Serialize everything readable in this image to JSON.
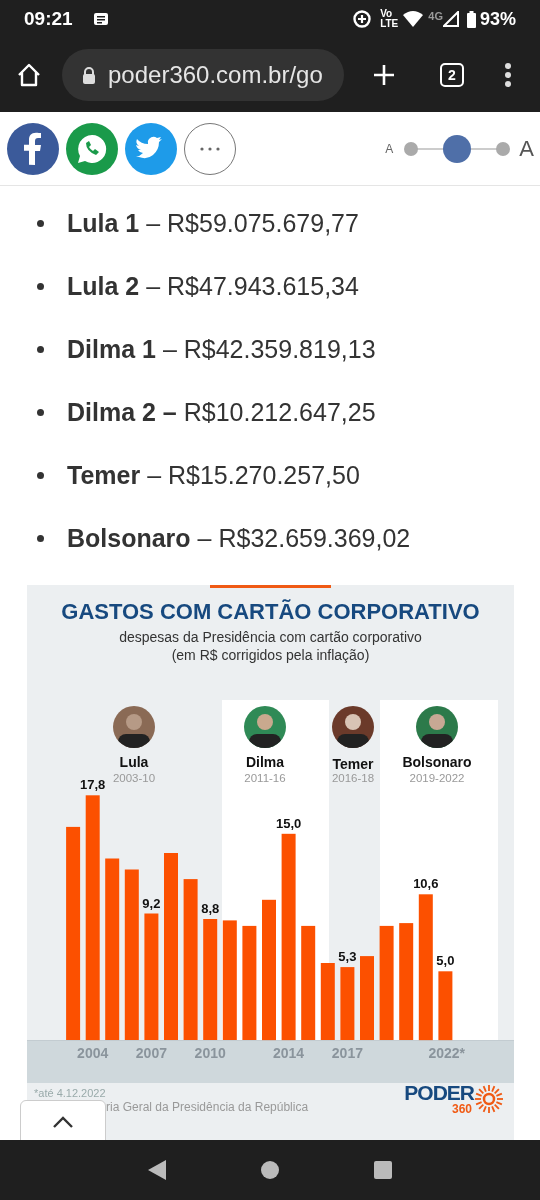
{
  "status_bar": {
    "time": "09:21",
    "volte_top": "Vo",
    "volte_bottom": "LTE",
    "network": "4G",
    "battery": "93%"
  },
  "browser": {
    "url": "poder360.com.br/go",
    "tab_count": "2"
  },
  "font_size_slider": {
    "small_label": "A",
    "large_label": "A",
    "level": 0.5
  },
  "spending_list": [
    {
      "text": "**Lula 1** – R$59.075.679,77"
    },
    {
      "text": "**Lula 2** – R$47.943.615,34"
    },
    {
      "text": "**Dilma 1** – R$42.359.819,13"
    },
    {
      "text": "**Dilma 2 –** R$10.212.647,25"
    },
    {
      "text": "**Temer** – R$15.270.257,50"
    },
    {
      "text": "**Bolsonaro** – R$32.659.369,02"
    }
  ],
  "chart": {
    "title": "GASTOS COM CARTÃO CORPORATIVO",
    "subtitle_lines": [
      "despesas da Presidência com cartão corporativo",
      "(em R$ corrigidos pela inflação)"
    ],
    "presidents": [
      {
        "name": "Lula",
        "period": "2003-10",
        "highlighted": false
      },
      {
        "name": "Dilma",
        "period": "2011-16",
        "highlighted": true
      },
      {
        "name": "Temer",
        "period": "2016-18",
        "highlighted": false
      },
      {
        "name": "Bolsonaro",
        "period": "2019-2022",
        "highlighted": true
      }
    ],
    "chart_data": {
      "type": "bar",
      "xlim": [
        2000.65,
        2025.5
      ],
      "x": [
        2003,
        2004,
        2005,
        2006,
        2007,
        2008,
        2009,
        2010,
        2011,
        2012,
        2013,
        2014,
        2015,
        2016,
        2017,
        2018,
        2019,
        2020,
        2021,
        2022
      ],
      "values": [
        15.5,
        17.8,
        13.2,
        12.4,
        9.2,
        13.6,
        11.7,
        8.8,
        8.7,
        8.3,
        10.2,
        15.0,
        8.3,
        5.6,
        5.3,
        6.1,
        8.3,
        8.5,
        10.6,
        5.0
      ],
      "xticks": [
        {
          "value": 2004,
          "label": "2004"
        },
        {
          "value": 2007,
          "label": "2007"
        },
        {
          "value": 2010,
          "label": "2010"
        },
        {
          "value": 2014,
          "label": "2014"
        },
        {
          "value": 2017,
          "label": "2017"
        },
        {
          "value": 2022,
          "label": "2022*"
        }
      ],
      "value_labels": [
        null,
        "17,8",
        null,
        null,
        "9,2",
        null,
        null,
        "8,8",
        null,
        null,
        null,
        "15,0",
        null,
        null,
        "5,3",
        null,
        null,
        null,
        "10,6",
        "5,0"
      ]
    },
    "footnote": "*até 4.12.2022",
    "source": "ria Geral da Presidência da República",
    "logo": {
      "wordmark": "PODER",
      "number": "360"
    }
  }
}
